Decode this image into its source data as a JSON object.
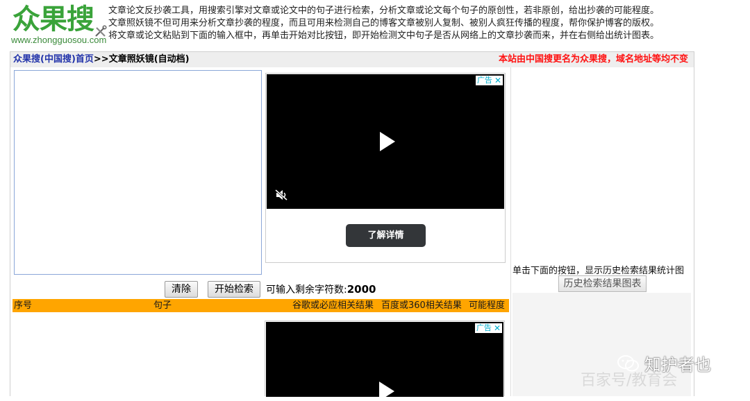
{
  "logo": {
    "name_cn": "众果搜",
    "url": "www.zhongguosou.com"
  },
  "intro": [
    "文章论文反抄袭工具，用搜索引擎对文章或论文中的句子进行检索，分析文章或论文每个句子的原创性，若非原创，给出抄袭的可能程度。",
    "文章照妖镜不但可用来分析文章抄袭的程度，而且可用来检测自己的博客文章被别人复制、被别人疯狂传播的程度，帮你保护博客的版权。",
    "将文章或论文粘贴到下面的输入框中，再单击开始对比按钮，即开始检测文中句子是否从网络上的文章抄袭而来，并在右侧给出统计图表。"
  ],
  "breadcrumb": {
    "home": "众果搜(中国搜)首页",
    "sep": ">>",
    "current": "文章照妖镜(自动档)"
  },
  "notice": "本站由中国搜更名为众果搜，域名地址等均不变",
  "input": {
    "value": "",
    "placeholder": ""
  },
  "ad": {
    "badge": "广告",
    "close": "✕",
    "cta": "了解详情"
  },
  "controls": {
    "clear": "清除",
    "start": "开始检索",
    "remain_label": "可输入剩余字符数:",
    "remain_value": "2000"
  },
  "table": {
    "headers": [
      "序号",
      "句子",
      "谷歌或必应相关结果",
      "百度或360相关结果",
      "可能程度"
    ]
  },
  "history": {
    "text": "单击下面的按钮，显示历史检索结果统计图",
    "button": "历史检索结果图表"
  },
  "watermark": {
    "text": "知护者也",
    "sub": "百家号/教育会"
  },
  "colors": {
    "logo_green": "#3aa33a",
    "notice_red": "#ff1010",
    "table_header": "#ffa500",
    "link_blue": "#2233aa"
  }
}
